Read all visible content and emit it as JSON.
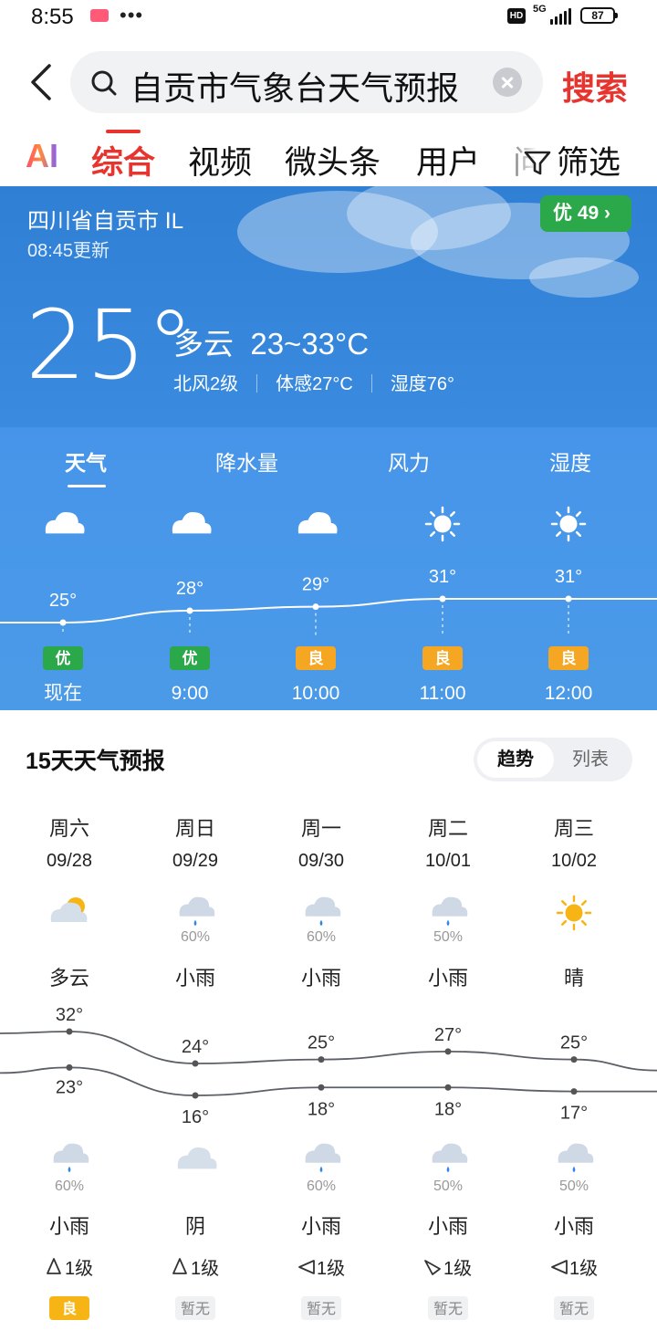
{
  "status_bar": {
    "time": "8:55",
    "more": "•••",
    "hd": "HD",
    "network": "5G",
    "battery": "87"
  },
  "search": {
    "query": "自贡市气象台天气预报",
    "button": "搜索"
  },
  "tabs": {
    "ai": "AI",
    "items": [
      "综合",
      "视频",
      "微头条",
      "用户",
      "问"
    ],
    "active": 0,
    "filter": "筛选"
  },
  "weather": {
    "location": "四川省自贡市 ⅠL",
    "updated": "08:45更新",
    "aqi": "优 49",
    "temperature": "25°",
    "condition": "多云",
    "range": "23~33°C",
    "wind": "北风2级",
    "feels_like": "体感27°C",
    "humidity": "湿度76°",
    "subtabs": [
      "天气",
      "降水量",
      "风力",
      "湿度"
    ],
    "hourly": [
      {
        "time": "现在",
        "temp": 25,
        "temp_label": "25°",
        "icon": "cloud-icon",
        "aqi": "优",
        "aqi_color": "#2ba84a"
      },
      {
        "time": "9:00",
        "temp": 28,
        "temp_label": "28°",
        "icon": "cloud-icon",
        "aqi": "优",
        "aqi_color": "#2ba84a"
      },
      {
        "time": "10:00",
        "temp": 29,
        "temp_label": "29°",
        "icon": "cloud-icon",
        "aqi": "良",
        "aqi_color": "#f5a623"
      },
      {
        "time": "11:00",
        "temp": 31,
        "temp_label": "31°",
        "icon": "sun-icon",
        "aqi": "良",
        "aqi_color": "#f5a623"
      },
      {
        "time": "12:00",
        "temp": 31,
        "temp_label": "31°",
        "icon": "sun-icon",
        "aqi": "良",
        "aqi_color": "#f5a623"
      }
    ]
  },
  "forecast": {
    "title": "15天天气预报",
    "toggle": {
      "trend": "趋势",
      "list": "列表"
    },
    "days": [
      {
        "weekday": "周六",
        "date": "09/28",
        "day_icon": "partly-cloudy-icon",
        "day_prob": "",
        "day_cond": "多云",
        "high": 32,
        "high_label": "32°",
        "low": 23,
        "low_label": "23°",
        "night_icon": "rain-icon",
        "night_prob": "60%",
        "night_cond": "小雨",
        "wind": "1级",
        "wind_dir": "north-wind-icon",
        "aqi": "良",
        "aqi_kind": "good"
      },
      {
        "weekday": "周日",
        "date": "09/29",
        "day_icon": "rain-icon",
        "day_prob": "60%",
        "day_cond": "小雨",
        "high": 24,
        "high_label": "24°",
        "low": 16,
        "low_label": "16°",
        "night_icon": "cloud-icon",
        "night_prob": "",
        "night_cond": "阴",
        "wind": "1级",
        "wind_dir": "north-wind-icon",
        "aqi": "暂无",
        "aqi_kind": "none"
      },
      {
        "weekday": "周一",
        "date": "09/30",
        "day_icon": "rain-icon",
        "day_prob": "60%",
        "day_cond": "小雨",
        "high": 25,
        "high_label": "25°",
        "low": 18,
        "low_label": "18°",
        "night_icon": "rain-icon",
        "night_prob": "60%",
        "night_cond": "小雨",
        "wind": "1级",
        "wind_dir": "east-wind-icon",
        "aqi": "暂无",
        "aqi_kind": "none"
      },
      {
        "weekday": "周二",
        "date": "10/01",
        "day_icon": "rain-icon",
        "day_prob": "50%",
        "day_cond": "小雨",
        "high": 27,
        "high_label": "27°",
        "low": 18,
        "low_label": "18°",
        "night_icon": "rain-icon",
        "night_prob": "50%",
        "night_cond": "小雨",
        "wind": "1级",
        "wind_dir": "northwest-wind-icon",
        "aqi": "暂无",
        "aqi_kind": "none"
      },
      {
        "weekday": "周三",
        "date": "10/02",
        "day_icon": "sun-icon",
        "day_prob": "",
        "day_cond": "晴",
        "high": 25,
        "high_label": "25°",
        "low": 17,
        "low_label": "17°",
        "night_icon": "rain-icon",
        "night_prob": "50%",
        "night_cond": "小雨",
        "wind": "1级",
        "wind_dir": "east-wind-icon",
        "aqi": "暂无",
        "aqi_kind": "none"
      }
    ]
  }
}
